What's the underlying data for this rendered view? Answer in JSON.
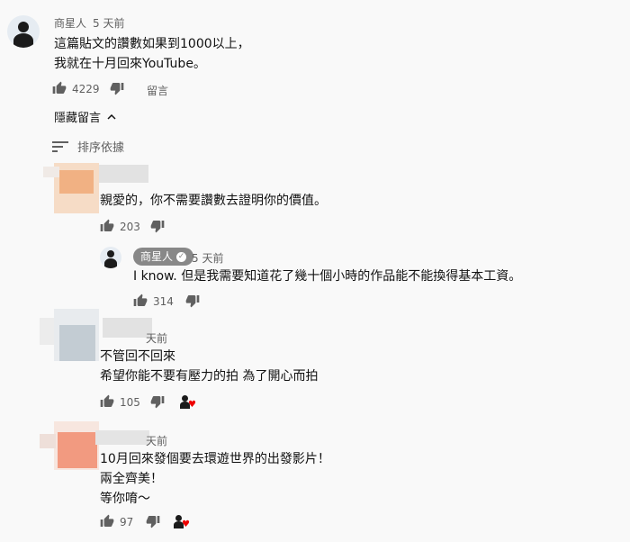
{
  "main_comment": {
    "author": "商星人",
    "time": "5 天前",
    "lines": [
      "這篇貼文的讚數如果到1000以上，",
      "我就在十月回來YouTube。"
    ],
    "likes": "4229",
    "reply_label": "留言"
  },
  "hide_replies_label": "隱藏留言",
  "sort_label": "排序依據",
  "replies": [
    {
      "text": "親愛的，你不需要讚數去證明你的價值。",
      "likes": "203"
    },
    {
      "author": "商星人",
      "time": "5 天前",
      "text": "I know. 但是我需要知道花了幾十個小時的作品能不能換得基本工資。",
      "likes": "314"
    },
    {
      "time": "天前",
      "lines": [
        "不管回不回來",
        "希望你能不要有壓力的拍 為了開心而拍"
      ],
      "likes": "105"
    },
    {
      "time": "天前",
      "lines": [
        "10月回來發個要去環遊世界的出發影片！",
        "兩全齊美！",
        "等你唷～"
      ],
      "likes": "97"
    }
  ],
  "colors": {
    "secondary": "#606060",
    "heart": "#e00000",
    "badge": "#888888"
  },
  "icons": [
    "thumbs-up-icon",
    "thumbs-down-icon",
    "sort-icon",
    "chevron-up-icon",
    "creator-heart-icon",
    "verified-check-icon"
  ]
}
